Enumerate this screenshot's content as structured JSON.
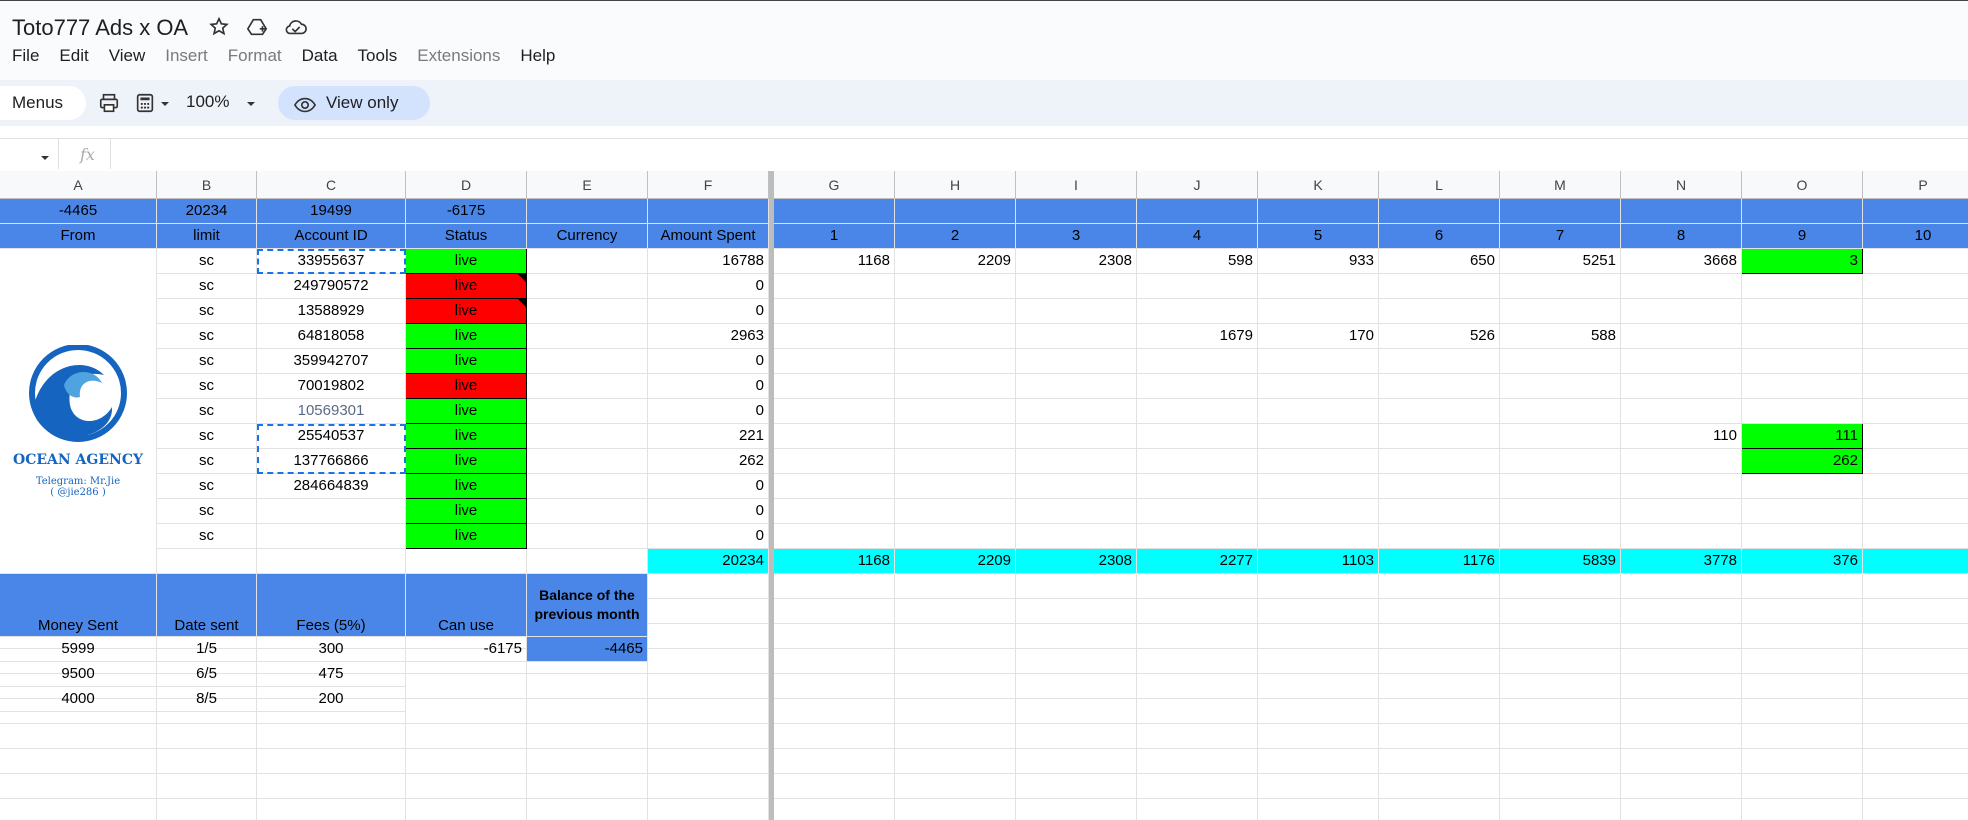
{
  "doc": {
    "title": "Toto777 Ads x OA",
    "icons": [
      "star-icon",
      "drive-shortcut-icon",
      "cloud-saved-icon"
    ]
  },
  "menubar": [
    "File",
    "Edit",
    "View",
    "Insert",
    "Format",
    "Data",
    "Tools",
    "Extensions",
    "Help"
  ],
  "menubar_disabled": [
    "Insert",
    "Format",
    "Extensions"
  ],
  "toolbar": {
    "menus_label": "Menus",
    "zoom": "100%",
    "view_only_label": "View only"
  },
  "formula_bar": {
    "fx": "fx"
  },
  "logo": {
    "name": "OCEAN AGENCY",
    "telegram": "Telegram: Mr.Jie",
    "handle": "( @jie286 )",
    "color": "#1565c0"
  },
  "columns": [
    "A",
    "B",
    "C",
    "D",
    "E",
    "F",
    "G",
    "H",
    "I",
    "J",
    "K",
    "L",
    "M",
    "N",
    "O",
    "P"
  ],
  "colors": {
    "header_blue": "#4a86e8",
    "live_green": "#00ff00",
    "dead_red": "#ff0000",
    "total_cyan": "#00ffff"
  },
  "sheet": {
    "summary_row": {
      "A": "-4465",
      "B": "20234",
      "C": "19499",
      "D": "-6175"
    },
    "header_row": {
      "A": "From",
      "B": "limit",
      "C": "Account ID",
      "D": "Status",
      "E": "Currency",
      "F": "Amount Spent",
      "G": "1",
      "H": "2",
      "I": "3",
      "J": "4",
      "K": "5",
      "L": "6",
      "M": "7",
      "N": "8",
      "O": "9",
      "P": "10"
    },
    "accounts": [
      {
        "limit": "sc",
        "id": "33955637",
        "status": "live",
        "status_color": "green",
        "amount": "16788",
        "days": {
          "G": "1168",
          "H": "2209",
          "I": "2308",
          "J": "598",
          "K": "933",
          "L": "650",
          "M": "5251",
          "N": "3668",
          "O": "3"
        }
      },
      {
        "limit": "sc",
        "id": "249790572",
        "status": "live",
        "status_color": "red",
        "note": true,
        "amount": "0",
        "days": {}
      },
      {
        "limit": "sc",
        "id": "13588929",
        "status": "live",
        "status_color": "red",
        "note": true,
        "amount": "0",
        "days": {}
      },
      {
        "limit": "sc",
        "id": "64818058",
        "status": "live",
        "status_color": "green",
        "amount": "2963",
        "days": {
          "J": "1679",
          "K": "170",
          "L": "526",
          "M": "588"
        }
      },
      {
        "limit": "sc",
        "id": "359942707",
        "status": "live",
        "status_color": "green",
        "amount": "0",
        "days": {}
      },
      {
        "limit": "sc",
        "id": "70019802",
        "status": "live",
        "status_color": "red",
        "amount": "0",
        "days": {}
      },
      {
        "limit": "sc",
        "id": "10569301",
        "status": "live",
        "status_color": "green",
        "amount": "0",
        "days": {}
      },
      {
        "limit": "sc",
        "id": "25540537",
        "status": "live",
        "status_color": "green",
        "amount": "221",
        "days": {
          "N": "110",
          "O": "111"
        }
      },
      {
        "limit": "sc",
        "id": "137766866",
        "status": "live",
        "status_color": "green",
        "amount": "262",
        "days": {
          "O": "262"
        }
      },
      {
        "limit": "sc",
        "id": "284664839",
        "status": "live",
        "status_color": "green",
        "amount": "0",
        "days": {}
      },
      {
        "limit": "sc",
        "id": "",
        "status": "live",
        "status_color": "green",
        "amount": "0",
        "days": {}
      },
      {
        "limit": "sc",
        "id": "",
        "status": "live",
        "status_color": "green",
        "amount": "0",
        "days": {}
      }
    ],
    "totals_row": {
      "F": "20234",
      "G": "1168",
      "H": "2209",
      "I": "2308",
      "J": "2277",
      "K": "1103",
      "L": "1176",
      "M": "5839",
      "N": "3778",
      "O": "376"
    },
    "payment_header": {
      "A": "Money Sent",
      "B": "Date sent",
      "C": "Fees (5%)",
      "D": "Can use",
      "E": "Balance of the previous month"
    },
    "payments": [
      {
        "A": "5999",
        "B": "1/5",
        "C": "300",
        "D": "-6175",
        "E": "-4465"
      },
      {
        "A": "9500",
        "B": "6/5",
        "C": "475",
        "D": "",
        "E": ""
      },
      {
        "A": "4000",
        "B": "8/5",
        "C": "200",
        "D": "",
        "E": ""
      }
    ]
  }
}
